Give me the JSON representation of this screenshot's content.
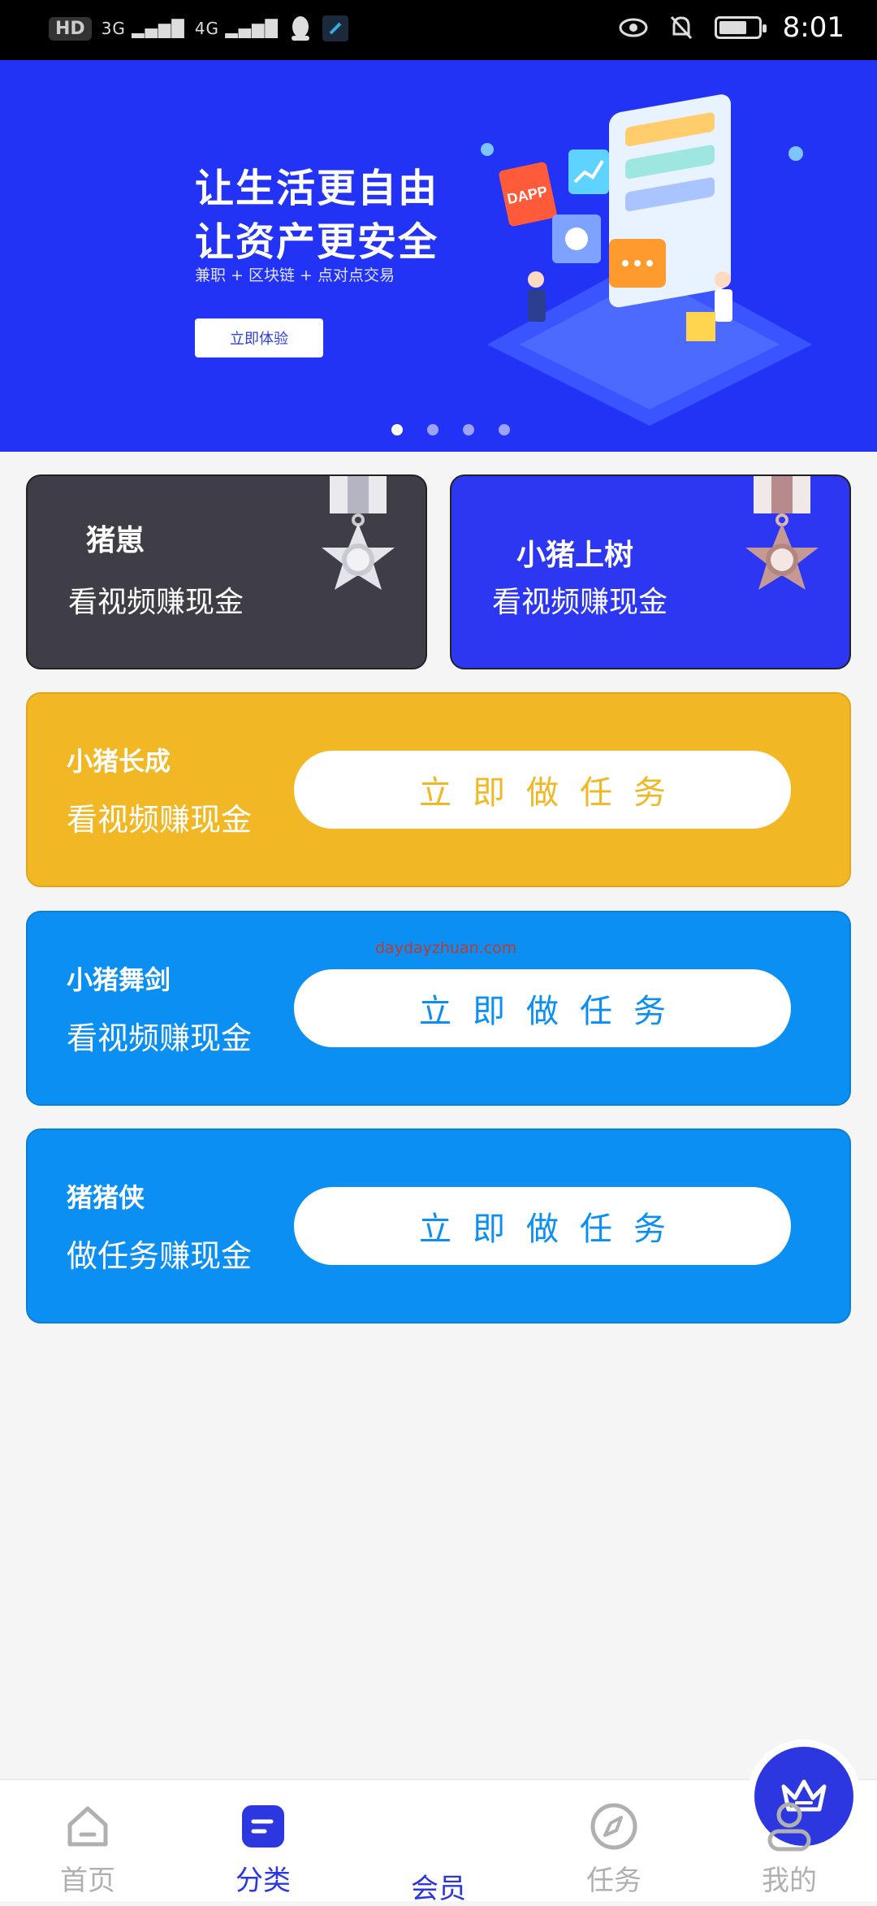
{
  "status_bar": {
    "left_chips": [
      "HD",
      "3G",
      "4G"
    ],
    "time": "8:01",
    "battery_level": 0.72
  },
  "banner": {
    "title_line1": "让生活更自由",
    "title_line2": "让资产更安全",
    "subtitle": "兼职 + 区块链 + 点对点交易",
    "button_label": "立即体验",
    "badge_dapp": "DAPP",
    "dots_count": 4,
    "active_dot": 0
  },
  "cards": [
    {
      "title": "猪崽",
      "subtitle": "看视频赚现金"
    },
    {
      "title": "小猪上树",
      "subtitle": "看视频赚现金"
    }
  ],
  "tasks": [
    {
      "title": "小猪长成",
      "subtitle": "看视频赚现金",
      "button": "立即做任务",
      "color": "#f2b724"
    },
    {
      "title": "小猪舞剑",
      "subtitle": "看视频赚现金",
      "button": "立即做任务",
      "color": "#0b8ff2"
    },
    {
      "title": "猪猪侠",
      "subtitle": "做任务赚现金",
      "button": "立即做任务",
      "color": "#0b8ff2"
    }
  ],
  "watermark": "daydayzhuan.com",
  "nav": {
    "home": "首页",
    "category": "分类",
    "member": "会员",
    "task": "任务",
    "mine": "我的",
    "active": "category"
  },
  "colors": {
    "primary": "#2d37e0",
    "banner_bg": "#2233f5",
    "dark_card": "#3f3e47",
    "yellow": "#f2b724",
    "sky": "#0b8ff2"
  }
}
